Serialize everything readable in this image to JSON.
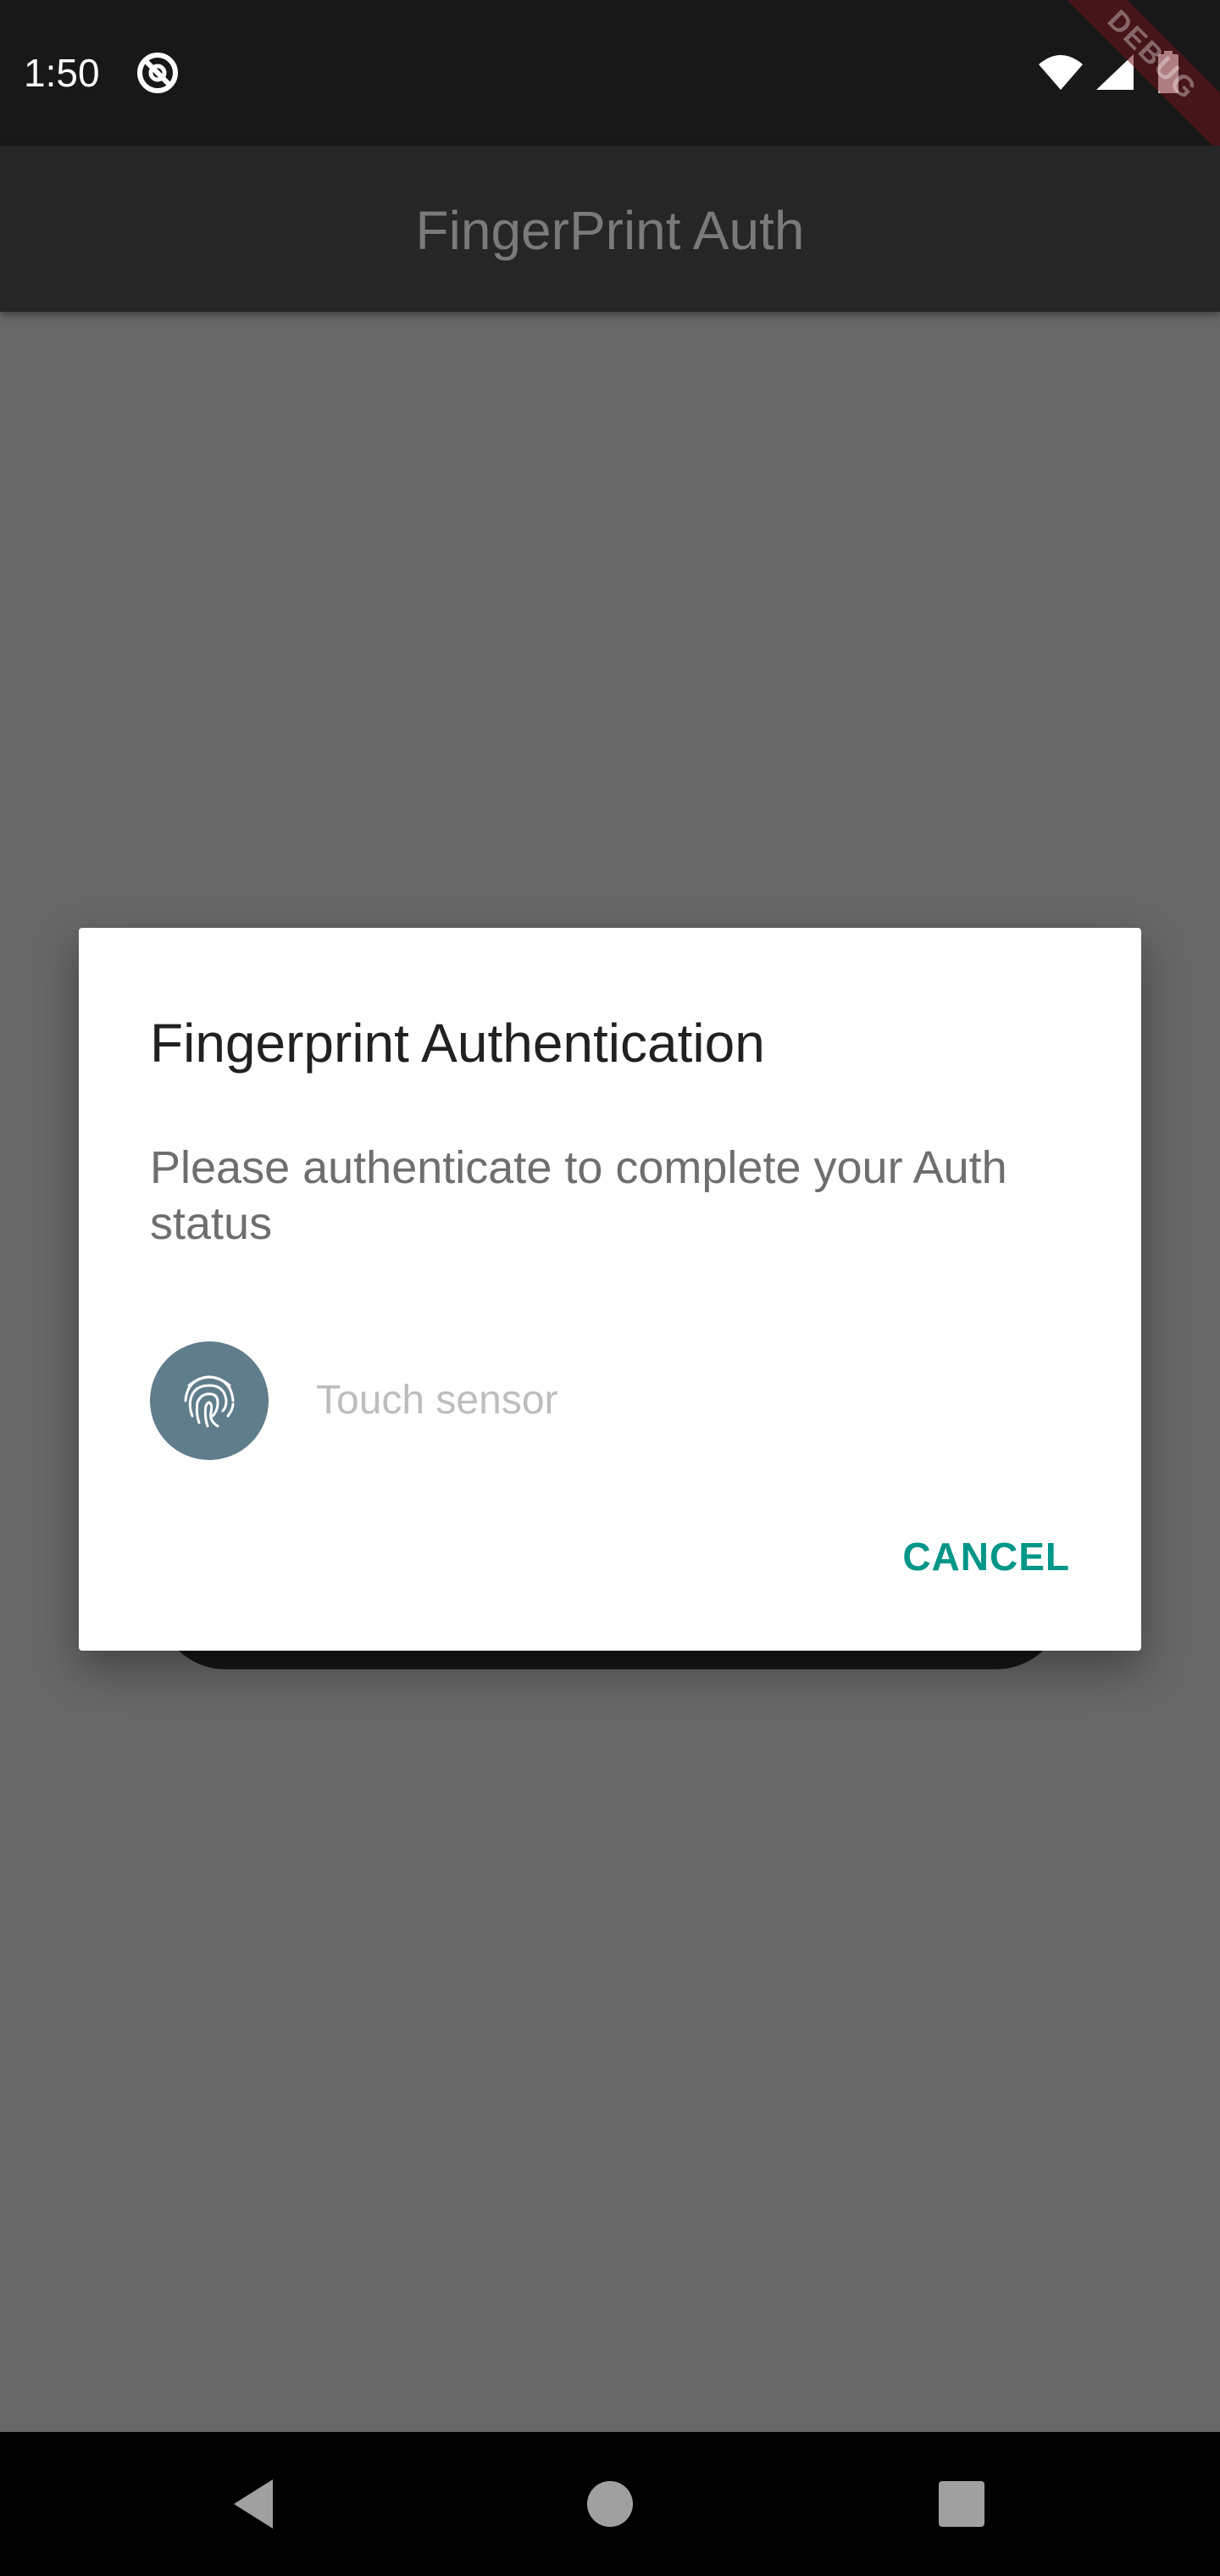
{
  "status_bar": {
    "time": "1:50",
    "app_icon": "do-not-disturb-icon",
    "wifi_icon": "wifi-icon",
    "signal_icon": "cell-signal-icon",
    "battery_icon": "battery-icon",
    "debug_banner": "DEBUG"
  },
  "app_bar": {
    "title": "FingerPrint Auth"
  },
  "dialog": {
    "title": "Fingerprint Authentication",
    "message": "Please authenticate to complete your Auth status",
    "fingerprint_icon": "fingerprint-icon",
    "sensor_hint": "Touch sensor",
    "cancel_label": "CANCEL"
  },
  "nav_bar": {
    "back_icon": "back-triangle-icon",
    "home_icon": "home-circle-icon",
    "recents_icon": "recents-square-icon"
  },
  "colors": {
    "accent": "#009688",
    "fingerprint_circle": "#607d8b",
    "scrim": "#676767"
  }
}
